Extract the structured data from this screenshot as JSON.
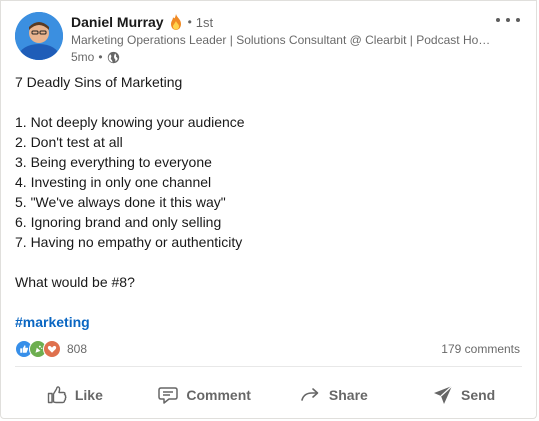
{
  "post": {
    "author": {
      "name": "Daniel Murray",
      "badge_icon": "fire-icon",
      "separator": "•",
      "connection_degree": "1st",
      "headline": "Marketing Operations Leader | Solutions Consultant @ Clearbit | Podcast Hos…",
      "time_ago": "5mo",
      "meta_separator": "•",
      "visibility_icon": "globe-icon"
    },
    "body_lines": [
      "7 Deadly Sins of Marketing",
      "",
      "1. Not deeply knowing your audience",
      "2. Don't test at all",
      "3. Being everything to everyone",
      "4. Investing in only one channel",
      "5. \"We've always done it this way\"",
      "6. Ignoring brand and only selling",
      "7. Having no empathy or authenticity",
      "",
      "What would be #8?"
    ],
    "hashtag": "#marketing",
    "reactions": {
      "icons": [
        "like-icon",
        "celebrate-icon",
        "love-icon"
      ],
      "count": "808"
    },
    "comments_count": "179 comments"
  },
  "actions": {
    "like": "Like",
    "comment": "Comment",
    "share": "Share",
    "send": "Send"
  },
  "colors": {
    "link_blue": "#0a66c2",
    "like_blue": "#378fe9",
    "celebrate_green": "#44712e",
    "love_red": "#df704d"
  }
}
